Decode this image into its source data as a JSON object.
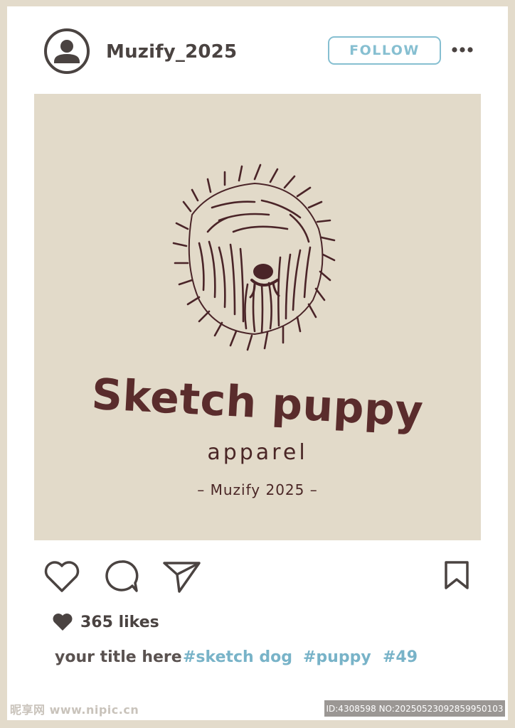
{
  "post": {
    "username": "Muzify_2025",
    "follow_label": "FOLLOW",
    "more_icon": "more-horizontal-icon",
    "avatar_icon": "user-avatar-icon"
  },
  "image": {
    "brand_title": "Sketch puppy",
    "brand_subtitle": "apparel",
    "brand_year": "– Muzify 2025 –"
  },
  "actions": {
    "like_icon": "heart-outline-icon",
    "comment_icon": "comment-bubble-icon",
    "share_icon": "send-paper-plane-icon",
    "save_icon": "bookmark-icon"
  },
  "likes": {
    "icon": "heart-filled-icon",
    "text": "365 likes"
  },
  "caption": {
    "title": "your title here",
    "hashtags": [
      "#sketch dog",
      "#puppy",
      "#49"
    ]
  },
  "watermark": {
    "left": "昵享网 www.nipic.cn",
    "right": "ID:4308598 NO:20250523092859950103"
  },
  "colors": {
    "background": "#e3dbcb",
    "card": "#ffffff",
    "accent": "#86bfd1",
    "hashtag": "#78b3c8",
    "text_dark": "#4a4341",
    "brand": "#5a2c2c",
    "photo_bg": "#e2dac9"
  }
}
